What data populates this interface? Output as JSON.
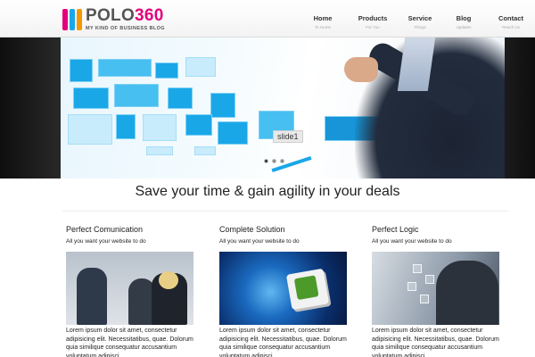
{
  "logo": {
    "brand_prefix": "POLO",
    "brand_number": "360",
    "tagline": "MY KIND OF BUSINESS BLOG",
    "bar_colors": [
      "#e4007c",
      "#1aa7e8",
      "#f39800"
    ]
  },
  "nav": [
    {
      "label": "Home",
      "sub": "To Home"
    },
    {
      "label": "Products",
      "sub": "For You"
    },
    {
      "label": "Service",
      "sub": "Things"
    },
    {
      "label": "Blog",
      "sub": "Updates"
    },
    {
      "label": "Contact",
      "sub": "Reach Us"
    }
  ],
  "slider": {
    "caption": "slide1",
    "slide_count": 3,
    "active_slide": 1
  },
  "headline": "Save your time & gain agility in your deals",
  "columns": [
    {
      "title": "Perfect Comunication",
      "subtitle": "All you want your website to do",
      "image": "business-team-photo",
      "text": "Lorem ipsum dolor sit amet, consectetur adipisicing elit. Necessitatibus, quae. Dolorum quia similique consequatur accusantium voluptatum adipisci"
    },
    {
      "title": "Complete Solution",
      "subtitle": "All you want your website to do",
      "image": "globe-keyboard-solutions-photo",
      "text": "Lorem ipsum dolor sit amet, consectetur adipisicing elit. Necessitatibus, quae. Dolorum quia similique consequatur accusantium voluptatum adipisci"
    },
    {
      "title": "Perfect Logic",
      "subtitle": "All you want your website to do",
      "image": "touchscreen-businessman-photo",
      "text": "Lorem ipsum dolor sit amet, consectetur adipisicing elit. Necessitatibus, quae. Dolorum quia similique consequatur accusantium voluptatum adipisci"
    }
  ],
  "colors": {
    "accent_blue": "#1aa7e8",
    "brand_pink": "#e4007c",
    "brand_orange": "#f39800"
  }
}
